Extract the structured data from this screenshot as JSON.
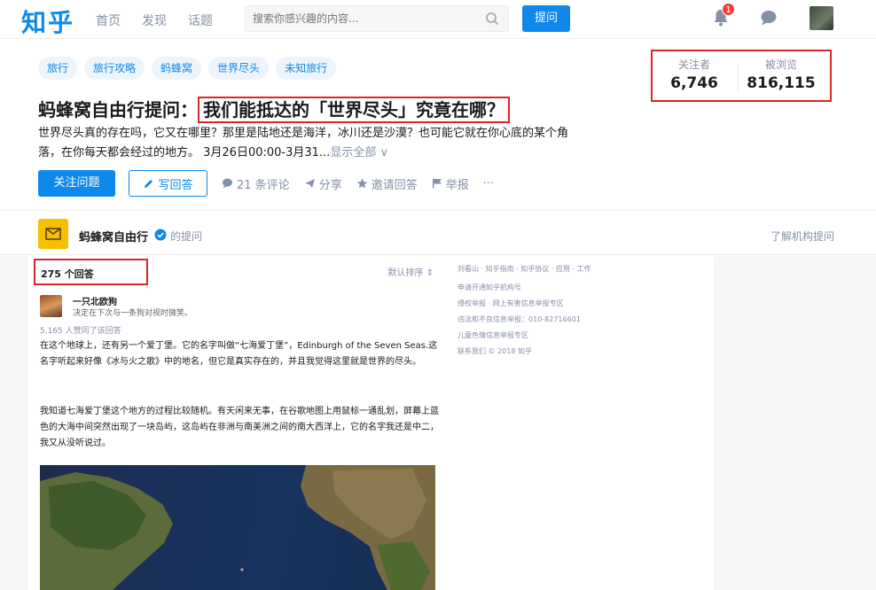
{
  "brand": {
    "logo": "知乎",
    "accent": "#0f88eb",
    "highlight_border": "#d92626"
  },
  "nav": {
    "items": [
      "首页",
      "发现",
      "话题"
    ]
  },
  "search": {
    "placeholder": "搜索你感兴趣的内容..."
  },
  "header": {
    "ask_label": "提问",
    "notification_count": "1"
  },
  "question": {
    "tags": [
      "旅行",
      "旅行攻略",
      "蚂蜂窝",
      "世界尽头",
      "未知旅行"
    ],
    "title_prefix": "蚂蜂窝自由行提问：",
    "title_highlight": "我们能抵达的「世界尽头」究竟在哪？",
    "description": "世界尽头真的存在吗，它又在哪里？那里是陆地还是海洋，冰川还是沙漠？也可能它就在你心底的某个角落，在你每天都会经过的地方。 3月26日00:00-3月31...",
    "show_all": "显示全部 ∨",
    "follow_label": "关注问题",
    "write_answer_label": "写回答",
    "comments_label": "21 条评论",
    "share_label": "分享",
    "invite_label": "邀请回答",
    "report_label": "举报",
    "more_label": "···"
  },
  "stats": {
    "followers_label": "关注者",
    "followers_value": "6,746",
    "views_label": "被浏览",
    "views_value": "816,115"
  },
  "org": {
    "name": "蚂蜂窝自由行",
    "suffix": "的提问",
    "link": "了解机构提问"
  },
  "answers": {
    "count_label": "275 个回答",
    "sort_label": "默认排序 ⇕",
    "first": {
      "author": "一只北欧狗",
      "bio": "决定在下次与一条狗对视时微笑。",
      "votes": "5,165 人赞同了该回答",
      "para1": "在这个地球上，还有另一个爱丁堡。它的名字叫做“七海爱丁堡”，Edinburgh of the Seven Seas.这名字听起来好像《冰与火之歌》中的地名，但它是真实存在的，并且我觉得这里就是世界的尽头。",
      "para2": "我知道七海爱丁堡这个地方的过程比较随机。有天闲来无事，在谷歌地图上用鼠标一通乱划，屏幕上蓝色的大海中间突然出现了一块岛屿，这岛屿在非洲与南美洲之间的南大西洋上，它的名字我还是中二，我又从没听说过。"
    }
  },
  "sidebar": {
    "lines": [
      "刘看山 · 知乎指南 · 知乎协议 · 应用 · 工作",
      "申请开通知乎机构号",
      "侵权举报 · 网上有害信息举报专区",
      "违法和不良信息举报：010-82716601",
      "儿童色情信息举报专区",
      "联系我们 © 2018 知乎"
    ]
  }
}
